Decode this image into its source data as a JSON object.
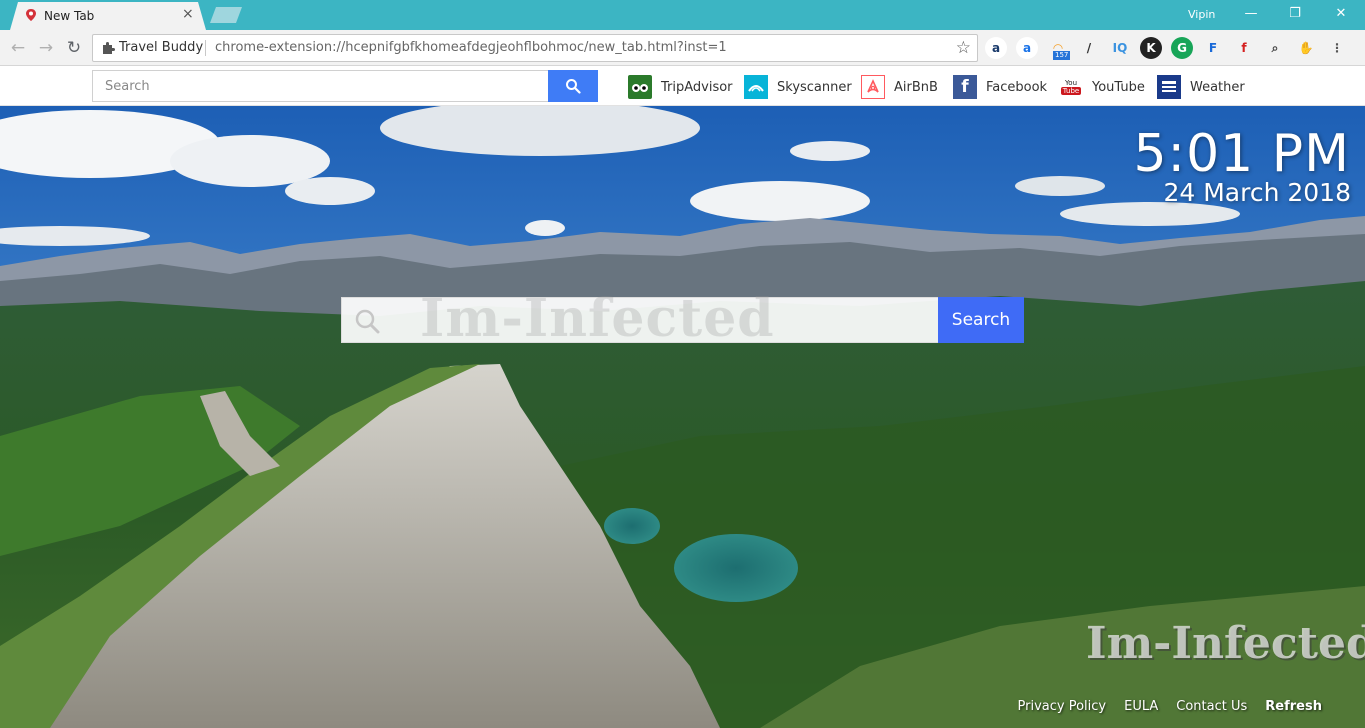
{
  "browser": {
    "tab_title": "New Tab",
    "tab_close": "×",
    "user_name": "Vipin",
    "window_controls": {
      "minimize": "—",
      "restore": "❐",
      "close": "✕"
    },
    "nav": {
      "back": "←",
      "forward": "→",
      "reload": "↻"
    },
    "omnibox_label": "Travel Buddy",
    "omnibox_url": "chrome-extension://hcepnifgbfkhomeafdegjeohflbohmoc/new_tab.html?inst=1",
    "bookmark_star": "☆",
    "extensions": [
      {
        "name": "a-translate-icon",
        "glyph": "a",
        "color": "#1a3a6b"
      },
      {
        "name": "a-circle-icon",
        "glyph": "a",
        "color": "#1a73e8"
      },
      {
        "name": "rss-icon",
        "glyph": "◠",
        "color": "#f4a02a",
        "badge": "157"
      },
      {
        "name": "dropper-icon",
        "glyph": "/",
        "color": "#333333"
      },
      {
        "name": "iq-icon",
        "glyph": "IQ",
        "color": "#3b93e0"
      },
      {
        "name": "k-icon",
        "glyph": "K",
        "color": "#ffffff"
      },
      {
        "name": "g-icon",
        "glyph": "G",
        "color": "#ffffff"
      },
      {
        "name": "f-blue-icon",
        "glyph": "F",
        "color": "#1a6ad8"
      },
      {
        "name": "f-red-icon",
        "glyph": "f",
        "color": "#d42020"
      },
      {
        "name": "magnifier-icon",
        "glyph": "⌕",
        "color": "#444444"
      },
      {
        "name": "puzzle-icon",
        "glyph": "✋",
        "color": "#777777"
      },
      {
        "name": "menu-icon",
        "glyph": "⋮",
        "color": "#555555"
      }
    ]
  },
  "topbar": {
    "search_placeholder": "Search",
    "links": [
      {
        "label": "TripAdvisor",
        "icon": "tripadvisor-icon",
        "color": "#00a680"
      },
      {
        "label": "Skyscanner",
        "icon": "skyscanner-icon",
        "color": "#00b2d6"
      },
      {
        "label": "AirBnB",
        "icon": "airbnb-icon",
        "color": "#ff5a5f"
      },
      {
        "label": "Facebook",
        "icon": "facebook-icon",
        "color": "#3b5998"
      },
      {
        "label": "YouTube",
        "icon": "youtube-icon",
        "color": "#cc181e"
      },
      {
        "label": "Weather",
        "icon": "weather-channel-icon",
        "color": "#1a3a8a"
      }
    ]
  },
  "clock": {
    "time": "5:01 PM",
    "date": "24 March 2018"
  },
  "main_search": {
    "button_label": "Search"
  },
  "watermark": {
    "text": "Im-Infected"
  },
  "footer": {
    "privacy": "Privacy Policy",
    "eula": "EULA",
    "contact": "Contact Us",
    "refresh": "Refresh"
  },
  "colors": {
    "tabstrip": "#3cb5c3",
    "search_button": "#3f6bf6",
    "accent_blue": "#3f7cf6"
  }
}
